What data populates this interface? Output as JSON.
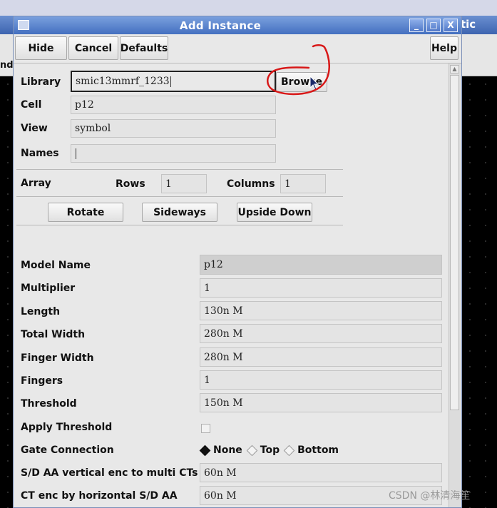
{
  "background": {
    "window_title_fragment": "tic",
    "left_text_fragment": "nd"
  },
  "dialog": {
    "title": "Add Instance",
    "window_buttons": {
      "minimize": "_",
      "maximize": "□",
      "close": "X"
    }
  },
  "toolbar": {
    "hide_label": "Hide",
    "cancel_label": "Cancel",
    "defaults_label": "Defaults",
    "help_label": "Help"
  },
  "form": {
    "library_label": "Library",
    "library_value": "smic13mmrf_1233",
    "browse_label": "Browse",
    "cell_label": "Cell",
    "cell_value": "p12",
    "view_label": "View",
    "view_value": "symbol",
    "names_label": "Names",
    "names_value": ""
  },
  "array": {
    "label": "Array",
    "rows_label": "Rows",
    "rows_value": "1",
    "columns_label": "Columns",
    "columns_value": "1"
  },
  "orientation": {
    "rotate_label": "Rotate",
    "sideways_label": "Sideways",
    "upside_down_label": "Upside Down"
  },
  "params": {
    "model_name_label": "Model Name",
    "model_name_value": "p12",
    "multiplier_label": "Multiplier",
    "multiplier_value": "1",
    "length_label": "Length",
    "length_value": "130n M",
    "total_width_label": "Total Width",
    "total_width_value": "280n M",
    "finger_width_label": "Finger Width",
    "finger_width_value": "280n M",
    "fingers_label": "Fingers",
    "fingers_value": "1",
    "threshold_label": "Threshold",
    "threshold_value": "150n M",
    "apply_threshold_label": "Apply Threshold",
    "apply_threshold_checked": false,
    "gate_connection_label": "Gate Connection",
    "gate_options": [
      "None",
      "Top",
      "Bottom"
    ],
    "gate_selected": "None",
    "sd_aa_vertical_label": "S/D AA vertical enc to multi CTs",
    "sd_aa_vertical_value": "60n M",
    "ct_enc_label": "CT enc by horizontal S/D AA",
    "ct_enc_value": "60n M"
  },
  "watermark": "CSDN @林清海笙",
  "colors": {
    "titlebar": "#4470c0",
    "annotation_red": "#d81818",
    "dialog_bg": "#e8e8e8"
  }
}
